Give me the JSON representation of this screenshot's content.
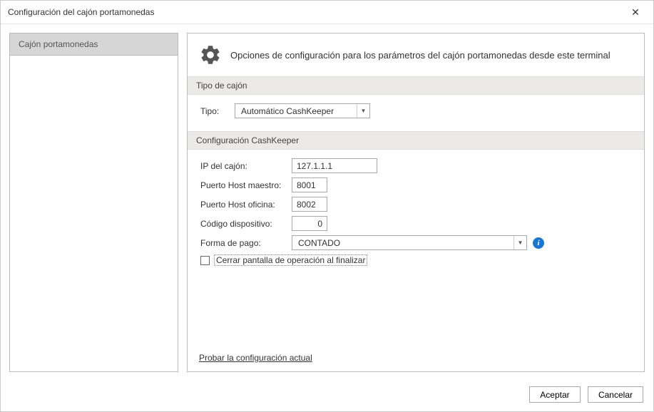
{
  "window": {
    "title": "Configuración del cajón portamonedas"
  },
  "sidebar": {
    "items": [
      {
        "label": "Cajón portamonedas"
      }
    ]
  },
  "header": {
    "description": "Opciones de configuración para los parámetros del cajón portamonedas desde este terminal"
  },
  "sections": {
    "tipo": {
      "title": "Tipo de cajón",
      "tipo_label": "Tipo:",
      "tipo_value": "Automático CashKeeper"
    },
    "cashkeeper": {
      "title": "Configuración CashKeeper",
      "ip_label": "IP del cajón:",
      "ip_value": "127.1.1.1",
      "puerto_maestro_label": "Puerto Host maestro:",
      "puerto_maestro_value": "8001",
      "puerto_oficina_label": "Puerto Host oficina:",
      "puerto_oficina_value": "8002",
      "codigo_label": "Código dispositivo:",
      "codigo_value": "0",
      "forma_pago_label": "Forma de pago:",
      "forma_pago_value": "CONTADO",
      "cerrar_checkbox_label": "Cerrar pantalla de operación al finalizar"
    }
  },
  "test_link": "Probar la configuración actual",
  "footer": {
    "accept": "Aceptar",
    "cancel": "Cancelar"
  }
}
